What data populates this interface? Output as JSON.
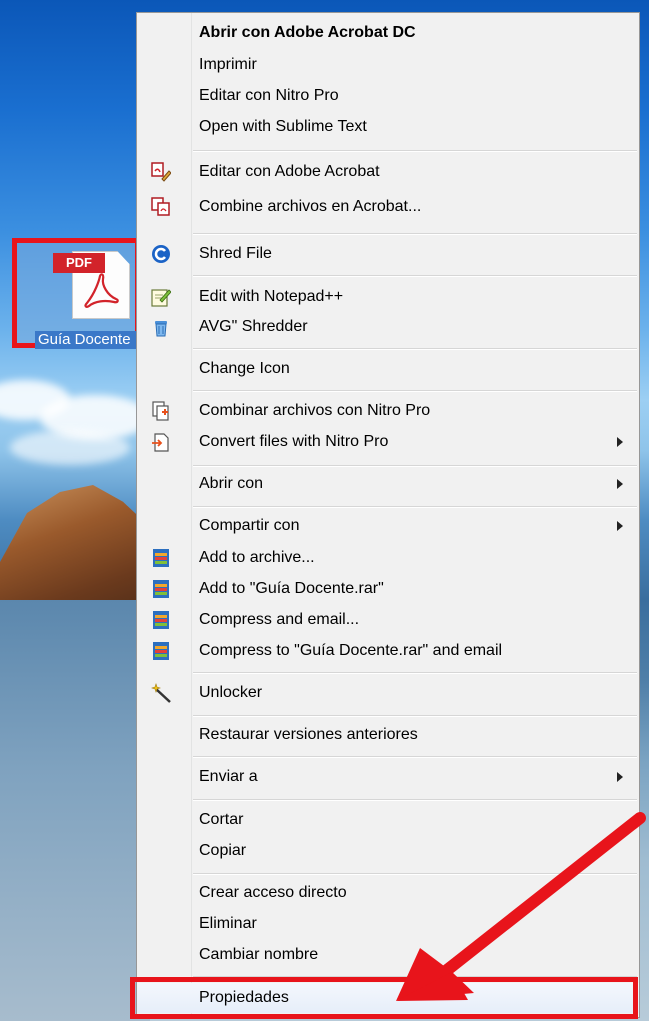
{
  "desktop": {
    "file_icon": {
      "badge": "PDF",
      "label": "Guía Docente",
      "icon": "pdf-file-icon"
    }
  },
  "context_menu": {
    "items": [
      {
        "label": "Abrir con Adobe Acrobat DC",
        "bold": true,
        "icon": null
      },
      {
        "label": "Imprimir",
        "icon": null
      },
      {
        "label": "Editar con Nitro Pro",
        "icon": null
      },
      {
        "label": "Open with Sublime Text",
        "icon": null
      },
      {
        "label": "Editar con Adobe Acrobat",
        "icon": "acrobat-edit-icon"
      },
      {
        "label": "Combine archivos en Acrobat...",
        "icon": "acrobat-combine-icon"
      },
      {
        "label": "Shred File",
        "icon": "shred-icon"
      },
      {
        "label": "Edit with Notepad++",
        "icon": "notepad-plus-plus-icon"
      },
      {
        "label": "AVG\" Shredder",
        "icon": "trash-can-icon"
      },
      {
        "label": "Change Icon",
        "icon": null
      },
      {
        "label": "Combinar archivos con Nitro Pro",
        "icon": "nitro-combine-icon"
      },
      {
        "label": "Convert files with Nitro Pro",
        "icon": "nitro-convert-icon",
        "submenu": true
      },
      {
        "label": "Abrir con",
        "icon": null,
        "submenu": true
      },
      {
        "label": "Compartir con",
        "icon": null,
        "submenu": true
      },
      {
        "label": "Add to archive...",
        "icon": "winrar-icon"
      },
      {
        "label": "Add to \"Guía Docente.rar\"",
        "icon": "winrar-icon"
      },
      {
        "label": "Compress and email...",
        "icon": "winrar-icon"
      },
      {
        "label": "Compress to \"Guía Docente.rar\" and email",
        "icon": "winrar-icon"
      },
      {
        "label": "Unlocker",
        "icon": "magic-wand-icon"
      },
      {
        "label": "Restaurar versiones anteriores",
        "icon": null
      },
      {
        "label": "Enviar a",
        "icon": null,
        "submenu": true
      },
      {
        "label": "Cortar",
        "icon": null
      },
      {
        "label": "Copiar",
        "icon": null
      },
      {
        "label": "Crear acceso directo",
        "icon": null
      },
      {
        "label": "Eliminar",
        "icon": null
      },
      {
        "label": "Cambiar nombre",
        "icon": null
      },
      {
        "label": "Propiedades",
        "icon": null,
        "highlighted": true
      }
    ]
  },
  "colors": {
    "annotation_red": "#e8141b",
    "menu_background": "#f1f1f1",
    "pdf_red": "#d2232a"
  }
}
